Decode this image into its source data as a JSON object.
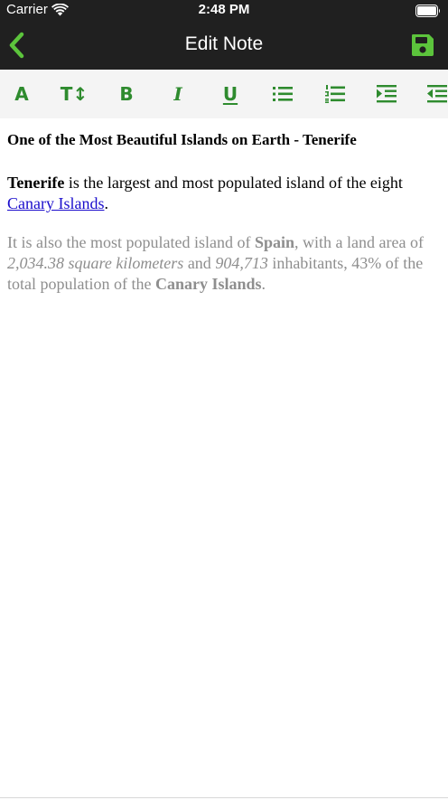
{
  "status_bar": {
    "carrier": "Carrier",
    "time": "2:48 PM"
  },
  "nav": {
    "title": "Edit Note",
    "back_icon": "chevron-left-icon",
    "save_icon": "floppy-disk-icon"
  },
  "toolbar": {
    "color": "#2e8b2e",
    "text_color_label": "A",
    "text_size_label": "T↕",
    "bold_label": "B",
    "italic_label": "I",
    "underline_label": "U",
    "icons": [
      "text-color-icon",
      "text-size-icon",
      "bold-icon",
      "italic-icon",
      "underline-icon",
      "bullet-list-icon",
      "numbered-list-icon",
      "indent-icon",
      "outdent-icon"
    ]
  },
  "note": {
    "title": "One of the Most Beautiful Islands on Earth - Tenerife",
    "para1": {
      "bold_start": "Tenerife",
      "text1": " is the largest and most populated island of the eight ",
      "link": "Canary Islands",
      "text2": "."
    },
    "para2": {
      "text1": "It is also the most populated island of ",
      "bold1": "Spain",
      "text2": ", with a land area of ",
      "italic1": "2,034.38 square kilometers",
      "text3": " and ",
      "italic2": "904,713",
      "text4": " inhabitants, 43% of the total population of the ",
      "bold2": "Canary Islands",
      "text5": "."
    }
  },
  "colors": {
    "accent": "#2e8b2e",
    "nav_bg": "#202020",
    "link": "#1a0dcc",
    "muted_text": "#8e8e8e"
  }
}
